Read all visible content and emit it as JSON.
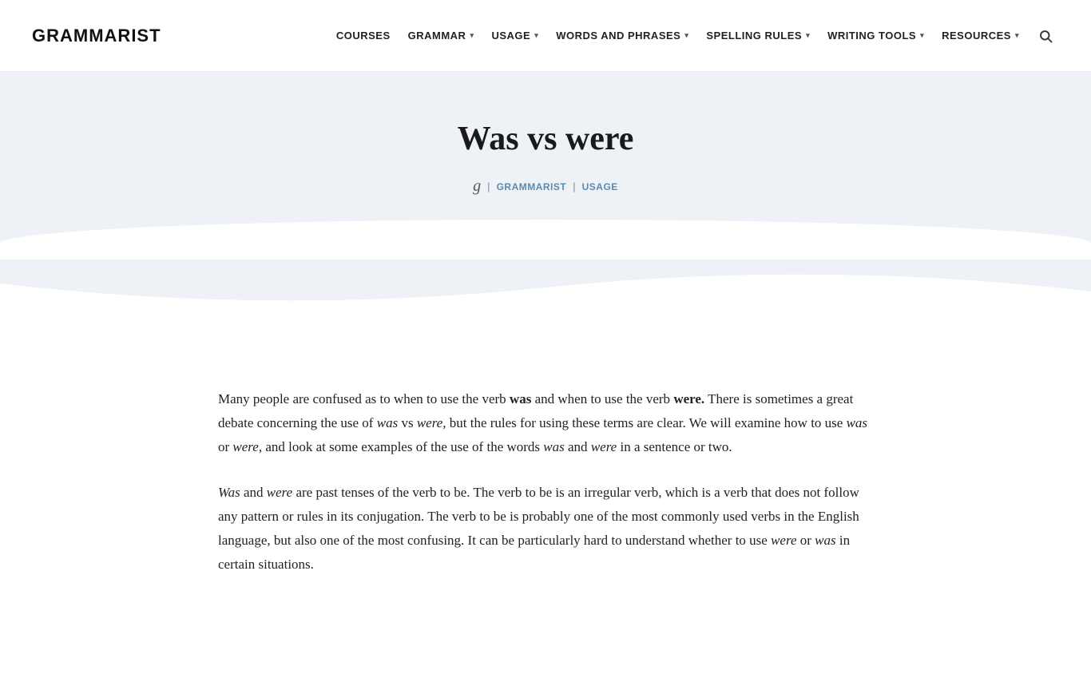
{
  "site": {
    "logo": "GRAMMARIST",
    "title": "Was vs were"
  },
  "nav": {
    "items": [
      {
        "label": "COURSES",
        "has_dropdown": false
      },
      {
        "label": "GRAMMAR",
        "has_dropdown": true
      },
      {
        "label": "USAGE",
        "has_dropdown": true
      },
      {
        "label": "WORDS AND PHRASES",
        "has_dropdown": true
      },
      {
        "label": "SPELLING RULES",
        "has_dropdown": true
      },
      {
        "label": "WRITING TOOLS",
        "has_dropdown": true
      },
      {
        "label": "RESOURCES",
        "has_dropdown": true
      }
    ],
    "search_label": "search"
  },
  "hero": {
    "title": "Was vs were",
    "g_icon": "g",
    "separator1": "|",
    "author_link": "GRAMMARIST",
    "separator2": "|",
    "category_link": "USAGE"
  },
  "content": {
    "paragraph1": "Many people are confused as to when to use the verb was and when to use the verb were. There is sometimes a great debate concerning the use of was vs were, but the rules for using these terms are clear. We will examine how to use was or were, and look at some examples of the use of the words was and were in a sentence or two.",
    "paragraph1_parts": {
      "prefix": "Many people are confused as to when to use the verb ",
      "was1": "was",
      "middle": " and when to use the verb ",
      "were1": "were.",
      "text2": " There is sometimes a great debate concerning the use of ",
      "was_italic": "was",
      "vs": " vs ",
      "were_italic": "were,",
      "text3": " but the rules for using these terms are clear. We will examine how to use ",
      "was2_italic": "was",
      "or": " or ",
      "were2_italic": "were,",
      "text4": " and look at some examples of the use of the words ",
      "was3_italic": "was",
      "and": " and ",
      "were3_italic": "were",
      "suffix": " in a sentence or two."
    },
    "paragraph2_parts": {
      "was_italic": "Was",
      "and": " and ",
      "were_italic": "were",
      "text": " are past tenses of the verb to be. The verb to be is an irregular verb, which is a verb that does not follow any pattern or rules in its conjugation. The verb to be is probably one of the most commonly used verbs in the English language, but also one of the most confusing. It can be particularly hard to understand whether to use ",
      "were_end_italic": "were",
      "or": " or ",
      "was_end_italic": "was",
      "suffix": " in certain situations."
    }
  }
}
